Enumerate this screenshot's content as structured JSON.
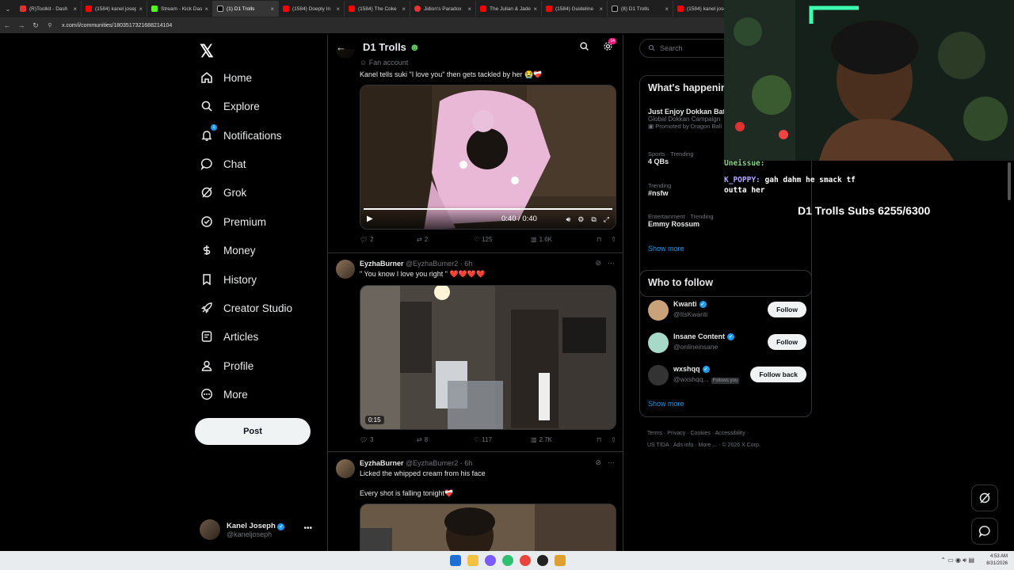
{
  "browser": {
    "tabs": [
      {
        "label": "(R)Toolkit - Dash",
        "color": "#d33"
      },
      {
        "label": "(1584) kanel joseph",
        "color": "#f00"
      },
      {
        "label": "Stream - Kick Das",
        "color": "#53fc18"
      },
      {
        "label": "(1) D1 Trolls",
        "color": "#fff",
        "active": true
      },
      {
        "label": "(1584) Doeply In",
        "color": "#f00"
      },
      {
        "label": "(1584) The Coke",
        "color": "#f00"
      },
      {
        "label": "Jidion's Paradox",
        "color": "#e33"
      },
      {
        "label": "The Julian & Jade",
        "color": "#f00"
      },
      {
        "label": "(1584) Guideline",
        "color": "#f00"
      },
      {
        "label": "(8) D1 Trolls",
        "color": "#fff"
      },
      {
        "label": "(1584) kanel jose",
        "color": "#f00"
      }
    ],
    "url": "x.com/i/communities/1803517321688214104"
  },
  "nav": {
    "items": [
      {
        "label": "Home",
        "icon": "home-icon"
      },
      {
        "label": "Explore",
        "icon": "search-icon"
      },
      {
        "label": "Notifications",
        "icon": "bell-icon",
        "badge": "1"
      },
      {
        "label": "Chat",
        "icon": "chat-icon"
      },
      {
        "label": "Grok",
        "icon": "grok-icon"
      },
      {
        "label": "Premium",
        "icon": "premium-icon"
      },
      {
        "label": "Money",
        "icon": "money-icon"
      },
      {
        "label": "History",
        "icon": "bookmark-icon"
      },
      {
        "label": "Creator Studio",
        "icon": "rocket-icon"
      },
      {
        "label": "Articles",
        "icon": "articles-icon"
      },
      {
        "label": "Profile",
        "icon": "profile-icon"
      },
      {
        "label": "More",
        "icon": "more-icon"
      }
    ],
    "post_label": "Post",
    "account": {
      "name": "Kanel Joseph",
      "handle": "@kaneljoseph"
    }
  },
  "feed": {
    "title": "D1 Trolls",
    "settings_badge": "14",
    "posts": [
      {
        "context": "Fan account",
        "text": "Kanel tells suki \"I love you\" then gets tackled by her 😭❤️‍🩹",
        "video_time": "0:40 / 0:40",
        "stats": {
          "replies": "2",
          "reposts": "2",
          "likes": "125",
          "views": "1.6K"
        }
      },
      {
        "name": "EyzhaBurner",
        "handle": "@EyzhaBurner2 · 6h",
        "text": "\" You know I love you right \" ❤️❤️❤️❤️",
        "video_time": "0:15",
        "stats": {
          "replies": "3",
          "reposts": "8",
          "likes": "117",
          "views": "2.7K"
        }
      },
      {
        "name": "EyzhaBurner",
        "handle": "@EyzhaBurner2 · 6h",
        "text": "Licked the whipped cream from his face",
        "text2": "Every shot is falling tonight❤️‍🩹"
      }
    ]
  },
  "right": {
    "search_placeholder": "Search",
    "happening_title": "What's happening",
    "trends": [
      {
        "meta": "",
        "name": "Just Enjoy Dokkan Battle",
        "sub": "Global Dokkan Campaign",
        "promo": "Promoted by Dragon Ball"
      },
      {
        "meta": "Sports · Trending",
        "name": "4 QBs",
        "sub": ""
      },
      {
        "meta": "Trending",
        "name": "#nsfw",
        "sub": ""
      },
      {
        "meta": "Entertainment · Trending",
        "name": "Emmy Rossum",
        "sub": ""
      }
    ],
    "show_more": "Show more",
    "follow_title": "Who to follow",
    "follows": [
      {
        "name": "Kwanti",
        "handle": "@ItsKwanti",
        "button": "Follow",
        "color": "#c9a27a"
      },
      {
        "name": "Insane Content",
        "handle": "@onlineinsane",
        "button": "Follow",
        "color": "#a7d9c9"
      },
      {
        "name": "wxshqq",
        "handle": "@wxshqq...",
        "follows_you": "Follows you",
        "button": "Follow back",
        "color": "#333"
      }
    ],
    "follow_show_more": "Show more",
    "footer": [
      "Terms",
      "Privacy",
      "Cookies",
      "Accessibility",
      "US TIDA",
      "Ads info",
      "More ...",
      "© 2026 X Corp."
    ]
  },
  "stream": {
    "chat": [
      {
        "user": "",
        "msg": "Uneissue: "
      },
      {
        "user": "K_POPPY:",
        "msg": "gah dahm he smack tf outta her"
      }
    ],
    "subs": "D1 Trolls Subs 6255/6300"
  },
  "taskbar": {
    "time": "4:53 AM",
    "date": "8/31/2026"
  },
  "colors": {
    "accent": "#1d9bf0",
    "background": "#000000",
    "follow_button": "#eff3f4"
  }
}
